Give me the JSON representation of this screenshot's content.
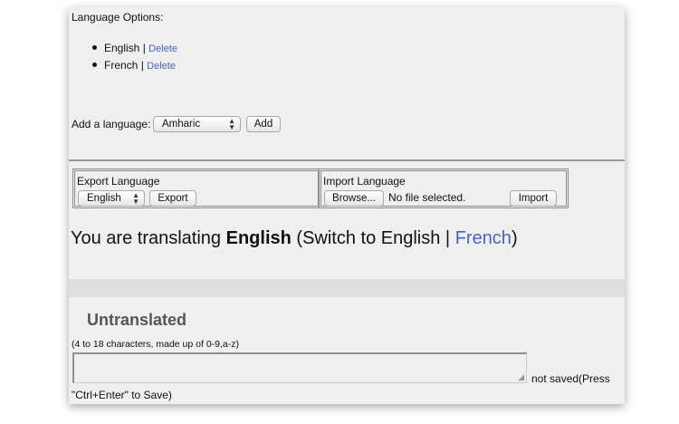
{
  "language_options": {
    "heading": "Language Options:",
    "items": [
      {
        "name": "English",
        "separator": "|",
        "delete_label": "Delete"
      },
      {
        "name": "French",
        "separator": "|",
        "delete_label": "Delete"
      }
    ],
    "add_label": "Add a language:",
    "add_select_value": "Amharic",
    "add_button": "Add"
  },
  "export": {
    "title": "Export Language",
    "select_value": "English",
    "button": "Export"
  },
  "import": {
    "title": "Import Language",
    "browse_button": "Browse...",
    "file_status": "No file selected.",
    "button": "Import"
  },
  "translating": {
    "prefix": "You are translating",
    "language": "English",
    "switch_prefix": "(Switch to English |",
    "switch_link": "French",
    "switch_suffix": ")"
  },
  "untranslated": {
    "heading": "Untranslated",
    "hint": "(4 to 18 characters, made up of 0-9,a-z)",
    "status_part1": "not saved(Press",
    "status_part2": "\"Ctrl+Enter\" to Save)"
  },
  "colors": {
    "link": "#4a63b8",
    "panel_bg": "#efefef"
  }
}
